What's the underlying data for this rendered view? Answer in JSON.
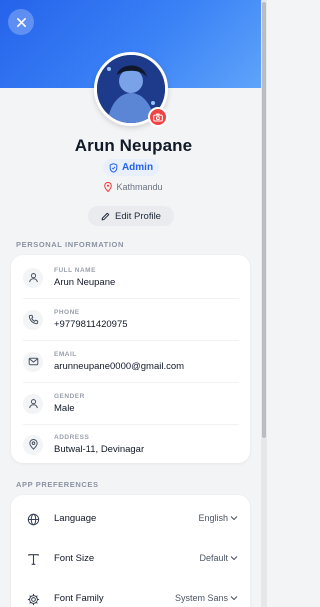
{
  "profile": {
    "name": "Arun Neupane",
    "role": "Admin",
    "location": "Kathmandu",
    "edit_label": "Edit Profile"
  },
  "personal": {
    "section_title": "PERSONAL INFORMATION",
    "fields": [
      {
        "label": "FULL NAME",
        "value": "Arun Neupane",
        "icon": "user-icon"
      },
      {
        "label": "PHONE",
        "value": "+9779811420975",
        "icon": "phone-icon"
      },
      {
        "label": "EMAIL",
        "value": "arunneupane0000@gmail.com",
        "icon": "mail-icon"
      },
      {
        "label": "GENDER",
        "value": "Male",
        "icon": "user-icon"
      },
      {
        "label": "ADDRESS",
        "value": "Butwal-11, Devinagar",
        "icon": "map-pin-icon"
      }
    ]
  },
  "preferences": {
    "section_title": "APP PREFERENCES",
    "items": [
      {
        "label": "Language",
        "value": "English",
        "icon": "globe-icon"
      },
      {
        "label": "Font Size",
        "value": "Default",
        "icon": "type-icon"
      },
      {
        "label": "Font Family",
        "value": "System Sans",
        "icon": "settings-icon"
      }
    ]
  },
  "colors": {
    "header": "#3b82f6",
    "accent": "#2563eb",
    "camera": "#ef4444",
    "location_pin": "#ef4444"
  }
}
